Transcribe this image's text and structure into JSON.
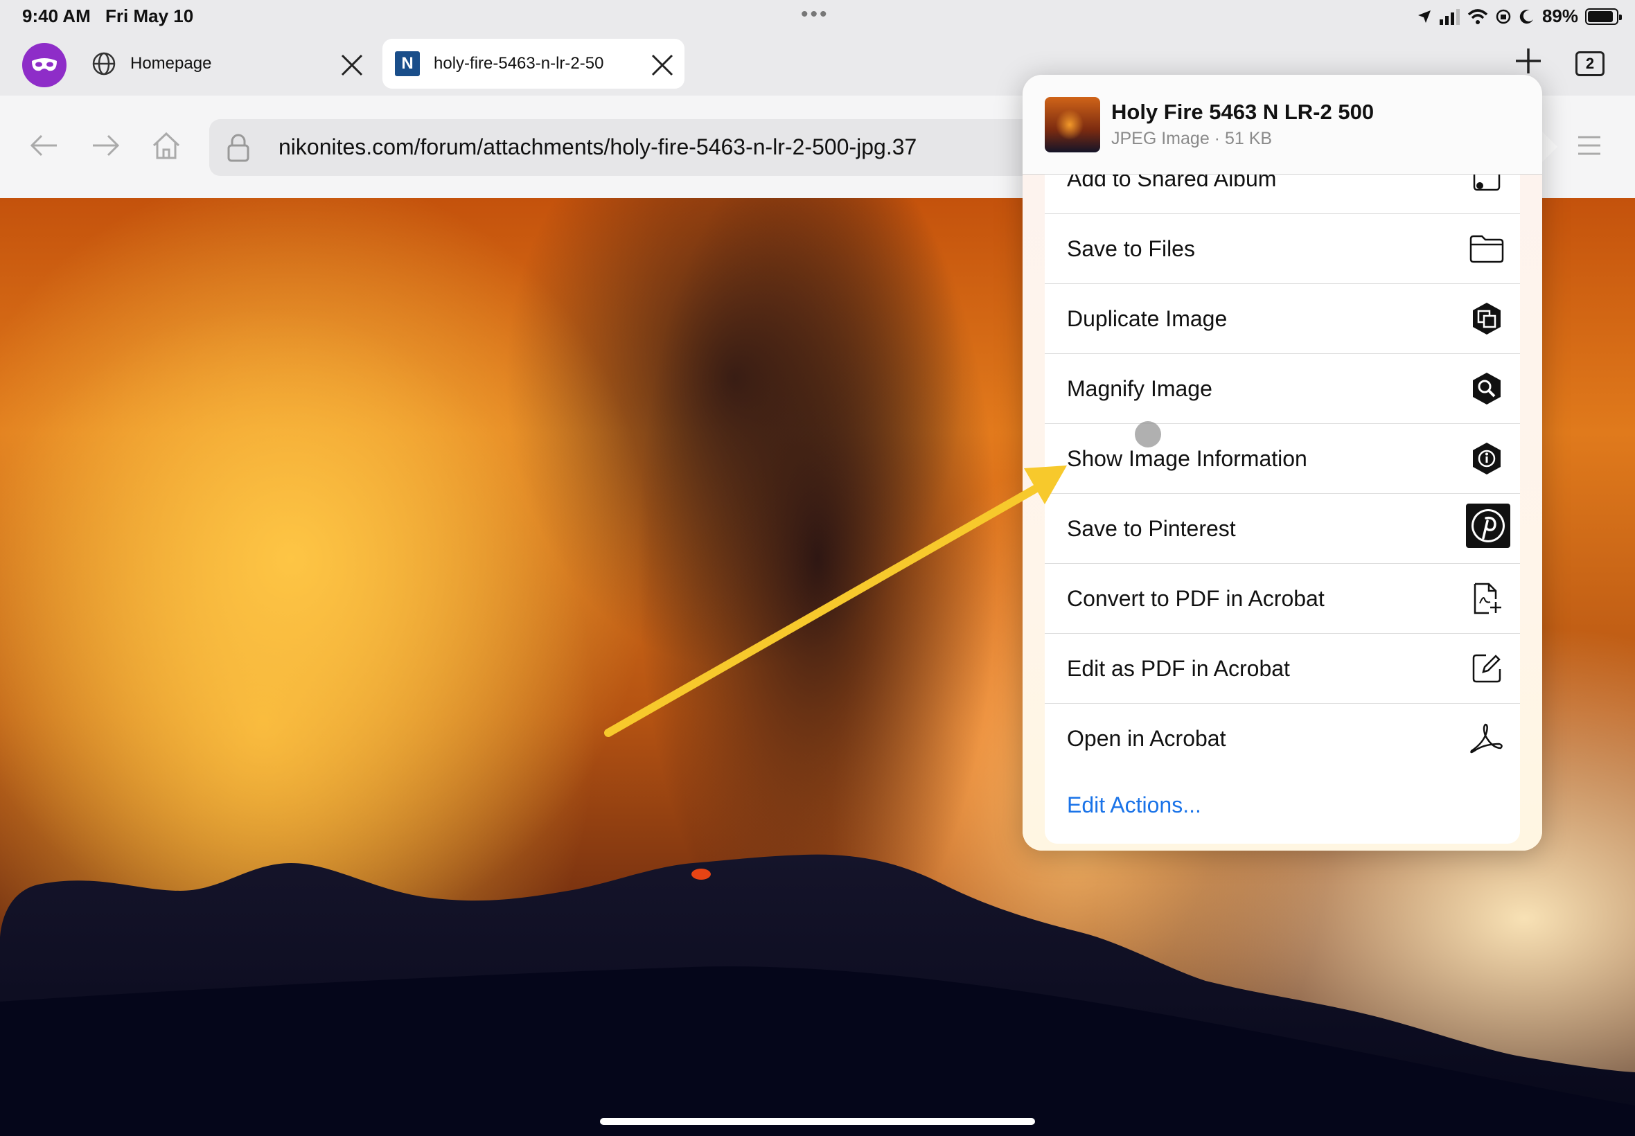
{
  "status_bar": {
    "time": "9:40 AM",
    "date": "Fri May 10",
    "battery_percent": "89%",
    "battery_level": 0.89,
    "multitask_dots": "•••"
  },
  "tabs": [
    {
      "title": "Homepage",
      "icon": "globe-icon",
      "active": false
    },
    {
      "title": "holy-fire-5463-n-lr-2-50",
      "icon": "nikonites-favicon",
      "favicon_letter": "N",
      "active": true
    }
  ],
  "tab_count": "2",
  "toolbar": {
    "url": "nikonites.com/forum/attachments/holy-fire-5463-n-lr-2-500-jpg.37"
  },
  "share_sheet": {
    "title": "Holy Fire 5463 N LR-2 500",
    "subtitle": "JPEG Image · 51 KB",
    "actions": [
      {
        "label": "Add to Shared Album",
        "icon": "shared-album-icon"
      },
      {
        "label": "Save to Files",
        "icon": "folder-icon"
      },
      {
        "label": "Duplicate Image",
        "icon": "duplicate-image-icon"
      },
      {
        "label": "Magnify Image",
        "icon": "magnify-image-icon"
      },
      {
        "label": "Show Image Information",
        "icon": "image-info-icon"
      },
      {
        "label": "Save to Pinterest",
        "icon": "pinterest-icon"
      },
      {
        "label": "Convert to PDF in Acrobat",
        "icon": "pdf-add-icon"
      },
      {
        "label": "Edit as PDF in Acrobat",
        "icon": "edit-pdf-icon"
      },
      {
        "label": "Open in Acrobat",
        "icon": "acrobat-icon"
      }
    ],
    "edit_actions_label": "Edit Actions...",
    "accent_color": "#1a73e8"
  },
  "annotation": {
    "arrow_color": "#f7c92c"
  }
}
